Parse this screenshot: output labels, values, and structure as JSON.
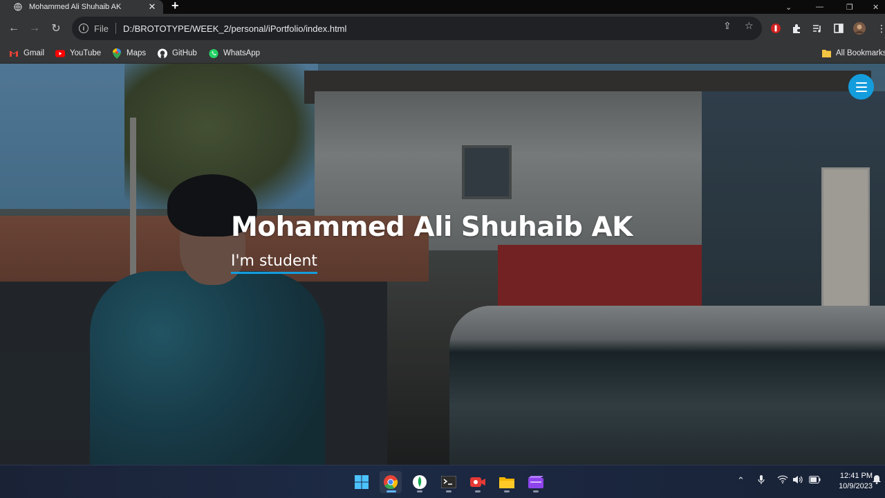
{
  "browser": {
    "tab": {
      "title": "Mohammed Ali Shuhaib AK"
    },
    "address_bar": {
      "scheme": "File",
      "url": "D:/BROTOTYPE/WEEK_2/personal/iPortfolio/index.html"
    },
    "bookmarks": [
      {
        "label": "Gmail",
        "icon": "gmail-icon",
        "color": "#ea4335"
      },
      {
        "label": "YouTube",
        "icon": "youtube-icon",
        "color": "#ff0000"
      },
      {
        "label": "Maps",
        "icon": "maps-icon",
        "color": "#34a853"
      },
      {
        "label": "GitHub",
        "icon": "github-icon",
        "color": "#ffffff"
      },
      {
        "label": "WhatsApp",
        "icon": "whatsapp-icon",
        "color": "#25d366"
      }
    ],
    "all_bookmarks": "All Bookmarks"
  },
  "page": {
    "hero": {
      "name": "Mohammed Ali Shuhaib AK",
      "subtitle": "I'm student"
    },
    "accent_color": "#149ddd"
  },
  "taskbar": {
    "apps": [
      "windows-start",
      "chrome",
      "mongodb",
      "terminal",
      "screen-recorder",
      "file-explorer",
      "clipchamp"
    ],
    "clock": {
      "time": "12:41 PM",
      "date": "10/9/2023"
    }
  }
}
